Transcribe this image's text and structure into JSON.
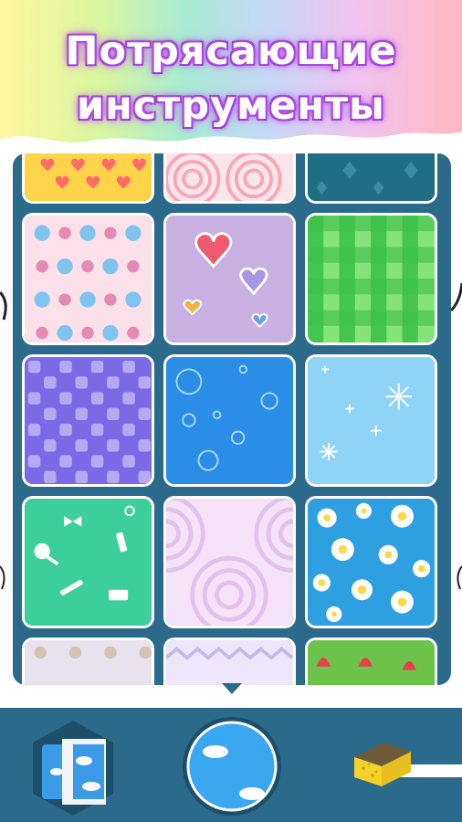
{
  "banner": {
    "title_line1": "Потрясающие",
    "title_line2": "инструменты",
    "title_glow_color": "#b04ee0"
  },
  "panel": {
    "background_color": "#2c6a8c",
    "patterns": [
      {
        "name": "yellow-hearts",
        "colors": [
          "#ffd44a",
          "#ff6b6b"
        ]
      },
      {
        "name": "pink-concentric-arcs",
        "colors": [
          "#fde6ea",
          "#f7a6b8"
        ]
      },
      {
        "name": "teal-damask",
        "colors": [
          "#1f6e86",
          "#3b8ba2"
        ]
      },
      {
        "name": "pink-blue-stars",
        "colors": [
          "#fce0ea",
          "#7fc3ef",
          "#e58ab3"
        ]
      },
      {
        "name": "lilac-paper-hearts",
        "colors": [
          "#c8b0e2",
          "#ef5a6e",
          "#a996e2",
          "#f2b44a",
          "#6aa3e0"
        ]
      },
      {
        "name": "green-gingham",
        "colors": [
          "#3ec24a",
          "#86e27a"
        ]
      },
      {
        "name": "purple-checkers",
        "colors": [
          "#7a6ae6",
          "#b9a9f4"
        ]
      },
      {
        "name": "blue-bubbles",
        "colors": [
          "#2a8de8",
          "#a9dbff"
        ]
      },
      {
        "name": "light-blue-snowflakes",
        "colors": [
          "#8fd3f7",
          "#ffffff"
        ]
      },
      {
        "name": "mint-beauty-tools",
        "colors": [
          "#3ccf9c",
          "#ffffff"
        ]
      },
      {
        "name": "lilac-concentric-arcs",
        "colors": [
          "#f4e2f7",
          "#e2c1ec"
        ]
      },
      {
        "name": "blue-daisies",
        "colors": [
          "#2ea0e2",
          "#ffffff",
          "#ffd84a"
        ]
      },
      {
        "name": "lavender-polka-dots",
        "colors": [
          "#e8e1ee",
          "#d4c2b4"
        ]
      },
      {
        "name": "lilac-chevron",
        "colors": [
          "#eee6fb",
          "#c9b6f0"
        ]
      },
      {
        "name": "green-tulips",
        "colors": [
          "#6dc24a",
          "#e8404a"
        ]
      }
    ]
  },
  "toolbar": {
    "tools": [
      {
        "name": "pattern-fill-tool",
        "selected": true,
        "colors": [
          "#3b9be6",
          "#ffffff"
        ]
      },
      {
        "name": "bubble-fill-tool",
        "selected": false,
        "colors": [
          "#3aa7f0",
          "#ffffff"
        ]
      },
      {
        "name": "sponge-eraser-tool",
        "selected": false,
        "colors": [
          "#f4d22a",
          "#6d5a3a"
        ]
      }
    ]
  }
}
